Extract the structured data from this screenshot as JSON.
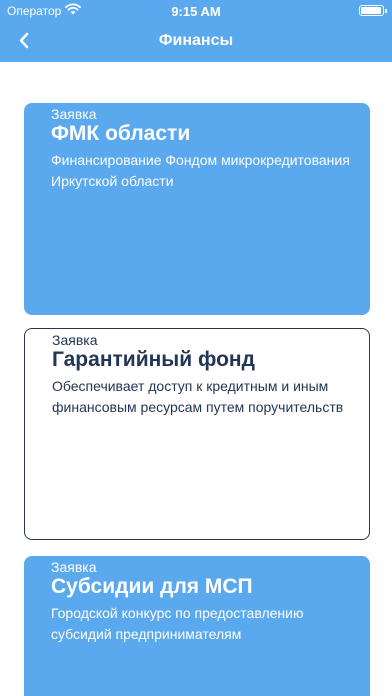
{
  "status_bar": {
    "carrier": "Оператор",
    "time": "9:15 AM",
    "wifi_icon": "wifi-icon",
    "battery_icon": "battery-icon"
  },
  "nav": {
    "title": "Финансы",
    "back_icon": "chevron-left-icon"
  },
  "colors": {
    "accent": "#5aa9ef",
    "dark_text": "#233655",
    "background": "#ffffff"
  },
  "cards": [
    {
      "tag": "Заявка",
      "title": "ФМК области",
      "description": "Финансирование Фондом микрокредитования Иркутской области",
      "style": "blue"
    },
    {
      "tag": "Заявка",
      "title": "Гарантийный фонд",
      "description": "Обеспечивает доступ к кредитным и иным финансовым ресурсам путем поручительств",
      "style": "white"
    },
    {
      "tag": "Заявка",
      "title": "Субсидии для МСП",
      "description": "Городской конкурс по предоставлению субсидий предпринимателям",
      "style": "blue"
    }
  ]
}
